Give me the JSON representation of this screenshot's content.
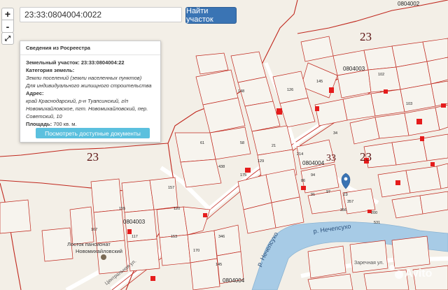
{
  "search": {
    "value": "23:33:0804004:0022",
    "button_label": "Найти участок"
  },
  "zoom": {
    "in_label": "+",
    "out_label": "-",
    "fullscreen_label": "⤢"
  },
  "info": {
    "title": "Сведения из Росреестра",
    "parcel_label": "Земельный участок:",
    "parcel_value": "23:33:0804004:22",
    "category_label": "Категория земель:",
    "category_value": "Земли поселений (земли населенных пунктов)",
    "usage_value": "Для индивидуального жилищного строительства",
    "address_label": "Адрес:",
    "address_line1": "край Краснодарский, р-н Туапсинский, г/п",
    "address_line2": "Новомихайловское, пгт. Новомихайловский, пер.",
    "address_line3": "Советский, 10",
    "area_label": "Площадь:",
    "area_value": "700 кв. м.",
    "docs_button": "Посмотреть доступные документы"
  },
  "map": {
    "quarter_labels": [
      "0804002",
      "0804003",
      "0804004",
      "0804003",
      "0804004"
    ],
    "region_labels": [
      "23",
      "23",
      "33",
      "23"
    ],
    "river_labels": [
      "р. Нечепсухо",
      "р. Нечепсухо"
    ],
    "street_labels": [
      "Центральная ул.",
      "Заречная ул."
    ],
    "poi_labels": [
      "Лосток пансионат",
      "Новомихайловский"
    ],
    "parcel_numbers": [
      "148",
      "126",
      "145",
      "58",
      "61",
      "438",
      "129",
      "175",
      "21",
      "214",
      "34",
      "91",
      "86",
      "94",
      "97",
      "357",
      "356",
      "200",
      "531",
      "155",
      "167",
      "117",
      "120",
      "153",
      "346",
      "170",
      "157",
      "145",
      "102",
      "103"
    ],
    "watermark": "Avito",
    "marker_label": "23",
    "colors": {
      "boundary": "#c0281e",
      "river": "#a7cbe6",
      "highlight": "#e51c1c",
      "water_text": "#2a4f7a"
    }
  }
}
